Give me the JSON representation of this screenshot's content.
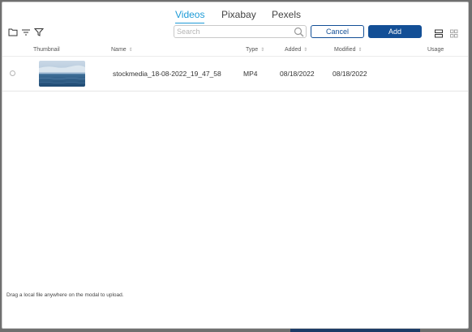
{
  "tabs": [
    {
      "label": "Videos",
      "active": true
    },
    {
      "label": "Pixabay",
      "active": false
    },
    {
      "label": "Pexels",
      "active": false
    }
  ],
  "toolbar": {
    "icons": [
      "folder-icon",
      "sort-lines-icon",
      "filter-icon"
    ],
    "search_placeholder": "Search",
    "search_value": "",
    "cancel_label": "Cancel",
    "add_label": "Add",
    "view_icons": [
      "list-view-icon",
      "grid-view-icon"
    ]
  },
  "table": {
    "columns": [
      {
        "label": "Thumbnail",
        "sortable": false
      },
      {
        "label": "Name",
        "sortable": true
      },
      {
        "label": "Type",
        "sortable": true
      },
      {
        "label": "Added",
        "sortable": true
      },
      {
        "label": "Modified",
        "sortable": true
      },
      {
        "label": "Usage",
        "sortable": false
      }
    ],
    "rows": [
      {
        "name": "stockmedia_18-08-2022_19_47_58",
        "type": "MP4",
        "added": "08/18/2022",
        "modified": "08/18/2022",
        "usage": ""
      }
    ]
  },
  "footer": {
    "hint": "Drag a local file anywhere on the modal to upload."
  },
  "colors": {
    "accent": "#1e9bd7",
    "primary": "#134f96",
    "backdrop": "#6f6f6f"
  }
}
